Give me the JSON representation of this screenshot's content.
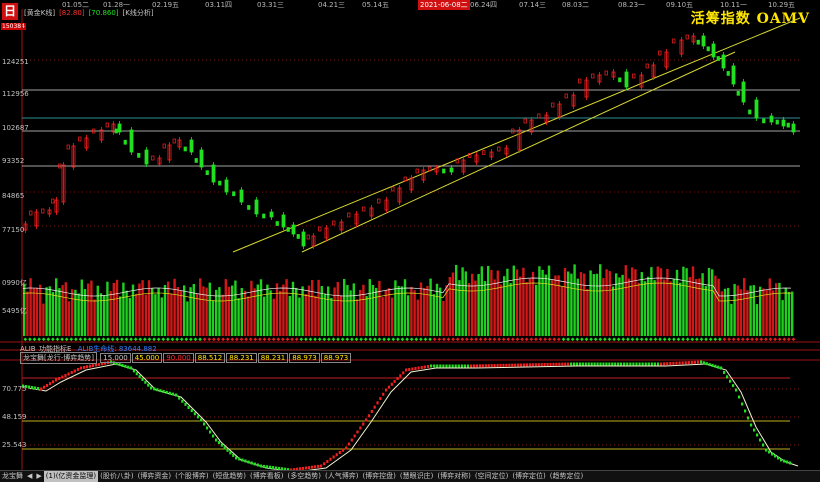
{
  "header": {
    "logo": "日",
    "logo_value": "150384",
    "legend": [
      {
        "text": "[黄金K线]",
        "color": "#c8c8c8"
      },
      {
        "text": "[82.80]",
        "color": "#ff3030"
      },
      {
        "text": "[70.860]",
        "color": "#20e020"
      },
      {
        "text": "[K线分析]",
        "color": "#c8c8c8"
      }
    ],
    "title": "活筹指数 OAMV"
  },
  "dates": [
    {
      "label": "01.05二",
      "highlight": false
    },
    {
      "label": "01.28一",
      "highlight": false
    },
    {
      "label": "02.19五",
      "highlight": false
    },
    {
      "label": "03.11四",
      "highlight": false
    },
    {
      "label": "03.31三",
      "highlight": false
    },
    {
      "label": "04.21三",
      "highlight": false
    },
    {
      "label": "05.14五",
      "highlight": false
    },
    {
      "label": "2021-06-08二",
      "highlight": true
    },
    {
      "label": "06.24四",
      "highlight": false
    },
    {
      "label": "07.14三",
      "highlight": false
    },
    {
      "label": "08.03二",
      "highlight": false
    },
    {
      "label": "08.23一",
      "highlight": false
    },
    {
      "label": "09.10五",
      "highlight": false
    },
    {
      "label": "10.11一",
      "highlight": false
    },
    {
      "label": "10.29五",
      "highlight": false
    }
  ],
  "price_axis": [
    "124251",
    "112956",
    "102687",
    "93352",
    "84865",
    "77150"
  ],
  "volume_axis": [
    "0990亿",
    "5495亿"
  ],
  "indicator_axis": [
    "70.775",
    "48.159",
    "25.543"
  ],
  "indicator1": {
    "label": "ALIB_功能指标E",
    "extra": "ALIB生命线: 83644.882"
  },
  "indicator2": {
    "name": "龙宝舞[龙行-博弈趋势]",
    "values": [
      {
        "text": "15.000",
        "color": "#c8c8c8"
      },
      {
        "text": "45.000",
        "color": "#ffe600"
      },
      {
        "text": "90.000",
        "color": "#ff3030"
      },
      {
        "text": "88.512",
        "color": "#ffe600"
      },
      {
        "text": "88.231",
        "color": "#ffe600"
      },
      {
        "text": "88.231",
        "color": "#ffe600"
      },
      {
        "text": "88.973",
        "color": "#ffe600"
      },
      {
        "text": "88.973",
        "color": "#ffe600"
      }
    ]
  },
  "tabs": [
    {
      "label": "龙宝舞",
      "active": false
    },
    {
      "label": "◀",
      "active": false
    },
    {
      "label": "▶",
      "active": false
    },
    {
      "label": "(1)(亿资金监理)",
      "active": true
    },
    {
      "label": "(股价八卦)",
      "active": false
    },
    {
      "label": "(博弈资金)",
      "active": false
    },
    {
      "label": "(个股博弈)",
      "active": false
    },
    {
      "label": "(短盘趋势)",
      "active": false
    },
    {
      "label": "(博弈看板)",
      "active": false
    },
    {
      "label": "(多空趋势)",
      "active": false
    },
    {
      "label": "(人气博弈)",
      "active": false
    },
    {
      "label": "(博弈控盘)",
      "active": false
    },
    {
      "label": "(慧眼识庄)",
      "active": false
    },
    {
      "label": "(博弈对称)",
      "active": false
    },
    {
      "label": "(空间定位)",
      "active": false
    },
    {
      "label": "(博弈定位)",
      "active": false
    },
    {
      "label": "(趋势定位)",
      "active": false
    }
  ],
  "colors": {
    "up": "#ff2020",
    "down": "#20e020",
    "channel": "#d8d830",
    "level": "#d8d8d8",
    "grid": "#7a1010"
  },
  "chart_data": {
    "type": "candlestick",
    "series_summary": "daily index candlesticks with volume bars and oscillator",
    "price_levels": [
      124251,
      112956,
      102687,
      93352,
      84865,
      77150
    ],
    "indicator_levels": [
      70.775,
      48.159,
      25.543
    ]
  }
}
